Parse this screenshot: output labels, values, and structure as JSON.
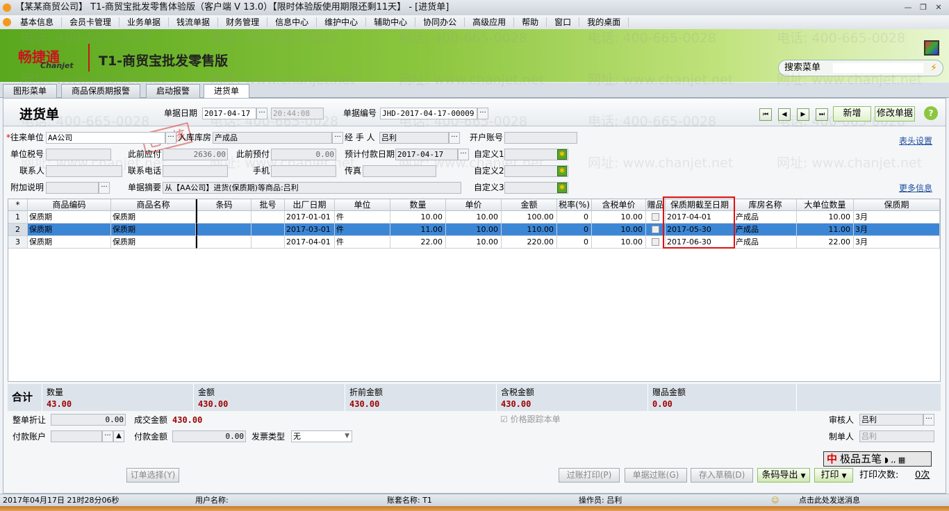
{
  "window": {
    "title": "【某某商贸公司】 T1-商贸宝批发零售体验版（客户端 V 13.0）【限时体验版使用期限还剩11天】 - [进货单]"
  },
  "menu": [
    "基本信息",
    "会员卡管理",
    "业务单据",
    "钱流单据",
    "财务管理",
    "信息中心",
    "维护中心",
    "辅助中心",
    "协同办公",
    "高级应用",
    "帮助",
    "窗口",
    "我的桌面"
  ],
  "banner": {
    "logo_cn": "畅捷通",
    "logo_en": "Chanjet",
    "product": "T1-商贸宝批发零售版",
    "search_label": "搜索菜单"
  },
  "tabs": [
    "图形菜单",
    "商品保质期报警",
    "启动报警",
    "进货单"
  ],
  "doc": {
    "title": "进货单",
    "date_label": "单据日期",
    "date": "2017-04-17",
    "time": "20:44:08",
    "no_label": "单据编号",
    "no": "JHD-2017-04-17-00009",
    "new_label": "新增",
    "edit_label": "修改单据",
    "help": "?",
    "stamp": "已审核",
    "header_settings": "表头设置",
    "more_info": "更多信息"
  },
  "fields": {
    "partner_label": "往来单位",
    "partner": "AA公司",
    "warehouse_label": "入库库房",
    "warehouse": "产成品",
    "handler_label": "经 手 人",
    "handler": "吕利",
    "account_label": "开户账号",
    "account": "",
    "taxno_label": "单位税号",
    "taxno": "",
    "prev_payable_label": "此前应付",
    "prev_payable": "2636.00",
    "prev_prepaid_label": "此前预付",
    "prev_prepaid": "0.00",
    "pay_date_label": "预计付款日期",
    "pay_date": "2017-04-17",
    "custom1_label": "自定义1",
    "contact_label": "联系人",
    "phone_label": "联系电话",
    "mobile_label": "手机",
    "fax_label": "传真",
    "custom2_label": "自定义2",
    "note_label": "附加说明",
    "summary_label": "单据摘要",
    "summary": "从【AA公司】进货(保质期)等商品:吕利",
    "custom3_label": "自定义3"
  },
  "table": {
    "columns": [
      "*",
      "商品编码",
      "商品名称",
      "条码",
      "批号",
      "出厂日期",
      "单位",
      "数量",
      "单价",
      "金额",
      "税率(%)",
      "含税单价",
      "赠品",
      "保质期截至日期",
      "库房名称",
      "大单位数量",
      "保质期"
    ],
    "rows": [
      [
        "1",
        "保质期",
        "保质期",
        "",
        "",
        "2017-01-01",
        "件",
        "10.00",
        "10.00",
        "100.00",
        "0",
        "10.00",
        "",
        "2017-04-01",
        "产成品",
        "10.00",
        "3月"
      ],
      [
        "2",
        "保质期",
        "保质期",
        "",
        "",
        "2017-03-01",
        "件",
        "11.00",
        "10.00",
        "110.00",
        "0",
        "10.00",
        "",
        "2017-05-30",
        "产成品",
        "11.00",
        "3月"
      ],
      [
        "3",
        "保质期",
        "保质期",
        "",
        "",
        "2017-04-01",
        "件",
        "22.00",
        "10.00",
        "220.00",
        "0",
        "10.00",
        "",
        "2017-06-30",
        "产成品",
        "22.00",
        "3月"
      ]
    ],
    "selected_row": 2
  },
  "totals": {
    "label": "合计",
    "items": [
      {
        "label": "数量",
        "value": "43.00"
      },
      {
        "label": "金额",
        "value": "430.00"
      },
      {
        "label": "折前金额",
        "value": "430.00"
      },
      {
        "label": "含税金额",
        "value": "430.00"
      },
      {
        "label": "赠品金额",
        "value": "0.00"
      }
    ]
  },
  "footer": {
    "discount_label": "整单折让",
    "discount": "0.00",
    "deal_label": "成交金额",
    "deal": "430.00",
    "price_track": "价格跟踪本单",
    "reviewer_label": "审核人",
    "reviewer": "吕利",
    "maker_label": "制单人",
    "maker": "吕利",
    "pay_account_label": "付款账户",
    "pay_amount_label": "付款金额",
    "pay_amount": "0.00",
    "invoice_label": "发票类型",
    "invoice": "无",
    "order_select": "订单选择(Y)",
    "post_print": "过账打印(P)",
    "post": "单据过账(G)",
    "draft": "存入草稿(D)",
    "barcode_export": "条码导出",
    "print": "打印",
    "print_count_label": "打印次数:",
    "print_count": "0次",
    "ime": "极品五笔"
  },
  "status": {
    "datetime": "2017年04月17日  21时28分06秒",
    "user": "用户名称:",
    "account": "账套名称: T1",
    "operator": "操作员: 吕利",
    "message": "点击此处发送消息"
  },
  "watermark": {
    "phone": "电话: 400-665-0028",
    "url": "网址: www.chanjet.net"
  },
  "colors": {
    "selected_row": "#3c86d6",
    "highlight_box": "#e01010",
    "total_value": "#9b0000",
    "banner_green": "#6fb52c"
  }
}
